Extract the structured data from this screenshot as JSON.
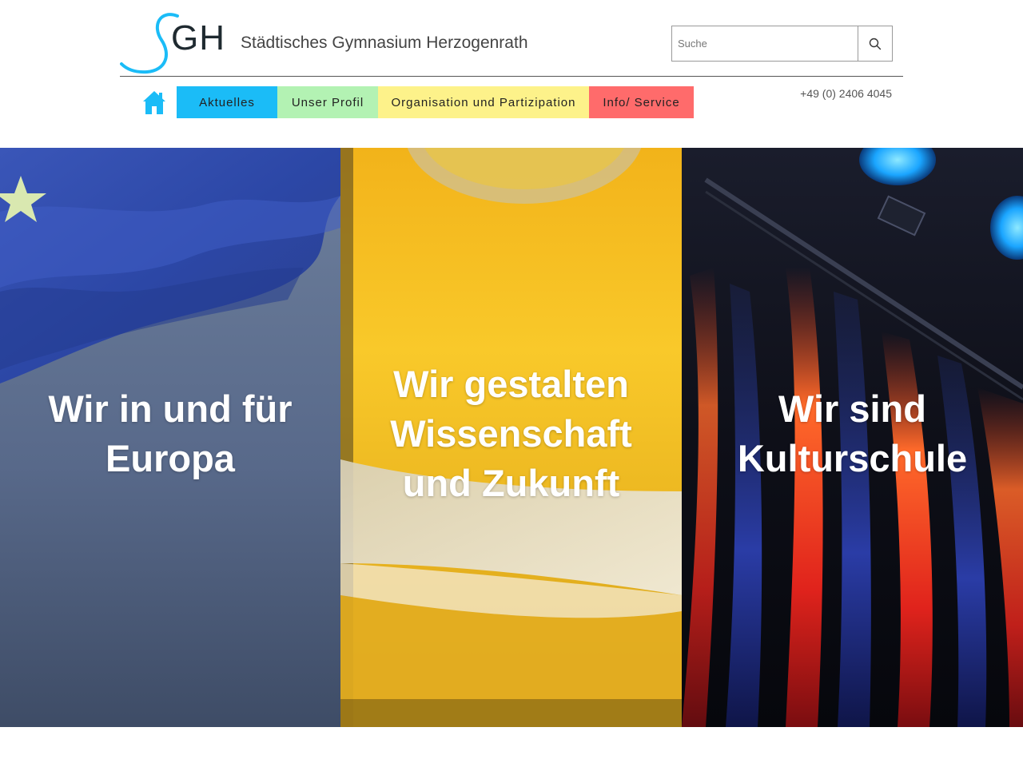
{
  "header": {
    "logo_letters": "GH",
    "school_name": "Städtisches Gymnasium Herzogenrath",
    "search": {
      "placeholder": "Suche",
      "value": ""
    },
    "phone": "+49 (0) 2406 4045"
  },
  "nav": {
    "home_icon": "home-icon",
    "items": [
      {
        "label": "Aktuelles",
        "color": "#1bbcf7"
      },
      {
        "label": "Unser Profil",
        "color": "#b3f2b3"
      },
      {
        "label": "Organisation und Partizipation",
        "color": "#fdf28a"
      },
      {
        "label": "Info/ Service",
        "color": "#ff6b6b"
      }
    ]
  },
  "hero": {
    "panels": [
      {
        "title_line1": "Wir in und für",
        "title_line2": "Europa"
      },
      {
        "title_line1": "Wir gestalten",
        "title_line2": "Wissenschaft",
        "title_line3": "und Zukunft"
      },
      {
        "title_line1": "Wir sind",
        "title_line2": "Kulturschule"
      }
    ]
  },
  "colors": {
    "accent_blue": "#1bbcf7",
    "nav_green": "#b3f2b3",
    "nav_yellow": "#fdf28a",
    "nav_red": "#ff6b6b"
  }
}
